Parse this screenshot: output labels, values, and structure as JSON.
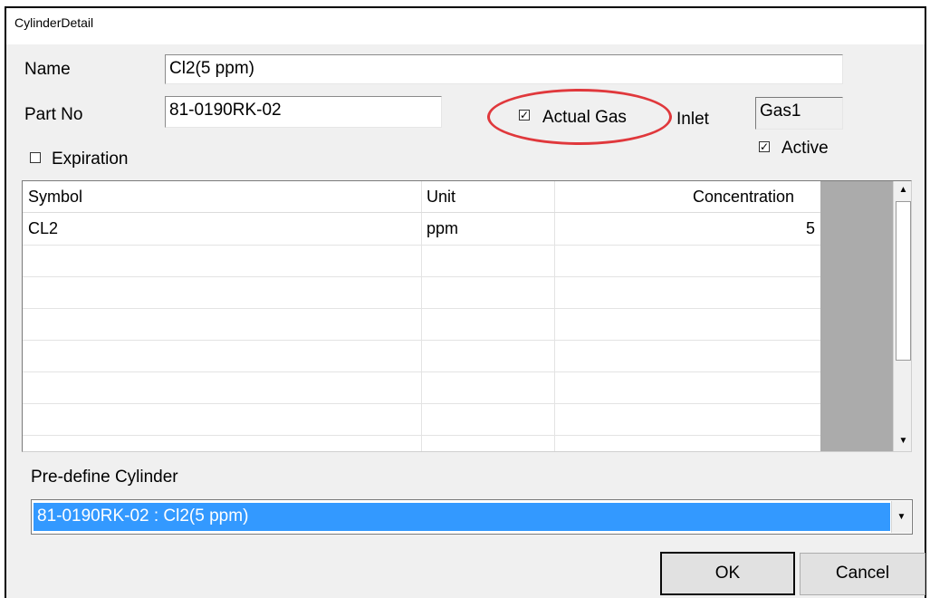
{
  "window": {
    "title": "CylinderDetail"
  },
  "form": {
    "name_label": "Name",
    "name_value": "Cl2(5 ppm)",
    "partno_label": "Part No",
    "partno_value": "81-0190RK-02",
    "expiration_label": "Expiration",
    "expiration_checked": false,
    "actual_gas_label": "Actual Gas",
    "actual_gas_checked": true,
    "inlet_label": "Inlet",
    "inlet_value": "Gas1",
    "active_label": "Active",
    "active_checked": true
  },
  "grid": {
    "headers": {
      "symbol": "Symbol",
      "unit": "Unit",
      "concentration": "Concentration"
    },
    "rows": [
      {
        "symbol": "CL2",
        "unit": "ppm",
        "concentration": "5"
      }
    ]
  },
  "predefine": {
    "label": "Pre-define Cylinder",
    "selected": "81-0190RK-02 : Cl2(5 ppm)"
  },
  "buttons": {
    "ok": "OK",
    "cancel": "Cancel"
  },
  "icons": {
    "check_mark": "✓",
    "scroll_up": "▲",
    "scroll_down": "▼",
    "dropdown": "▼"
  },
  "colors": {
    "highlight": "#e0383c",
    "selection": "#3399ff"
  }
}
